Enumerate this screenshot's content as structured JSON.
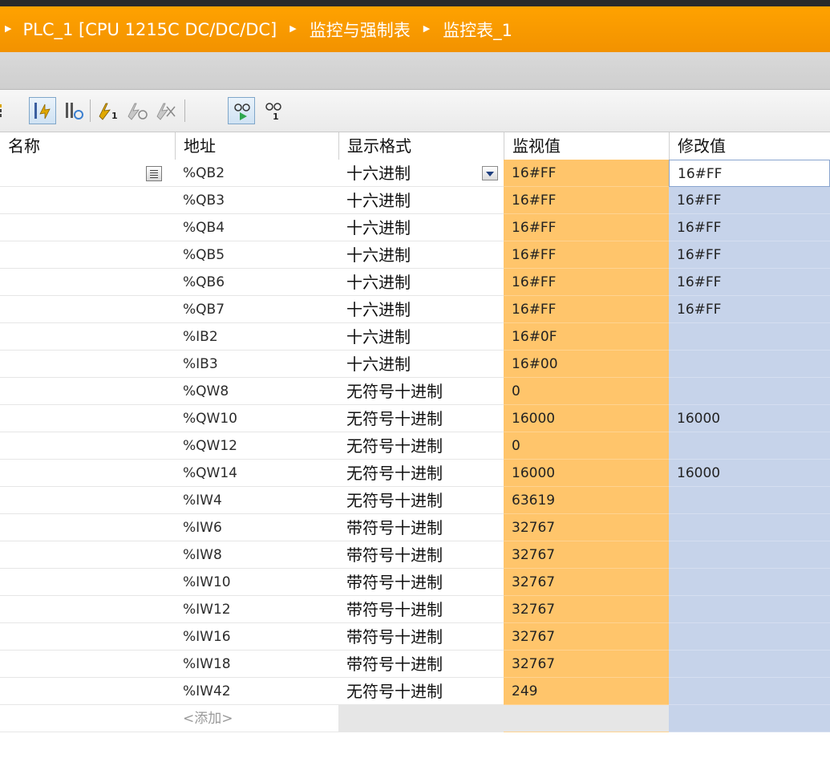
{
  "breadcrumb": {
    "items": [
      "PLC_1 [CPU 1215C DC/DC/DC]",
      "监控与强制表",
      "监控表_1"
    ]
  },
  "toolbar": {
    "icons": [
      "insert-row-icon",
      "monitor-all-icon",
      "monitor-once-icon",
      "modify-now-icon",
      "modify-trigger-icon",
      "enable-peripheral-icon",
      "monitor-all-toggle-icon",
      "monitor-once-glasses-icon"
    ]
  },
  "table": {
    "headers": {
      "name": "名称",
      "address": "地址",
      "format": "显示格式",
      "monitor": "监视值",
      "modify": "修改值"
    },
    "rows": [
      {
        "address": "%QB2",
        "format": "十六进制",
        "monitor": "16#FF",
        "modify": "16#FF"
      },
      {
        "address": "%QB3",
        "format": "十六进制",
        "monitor": "16#FF",
        "modify": "16#FF"
      },
      {
        "address": "%QB4",
        "format": "十六进制",
        "monitor": "16#FF",
        "modify": "16#FF"
      },
      {
        "address": "%QB5",
        "format": "十六进制",
        "monitor": "16#FF",
        "modify": "16#FF"
      },
      {
        "address": "%QB6",
        "format": "十六进制",
        "monitor": "16#FF",
        "modify": "16#FF"
      },
      {
        "address": "%QB7",
        "format": "十六进制",
        "monitor": "16#FF",
        "modify": "16#FF"
      },
      {
        "address": "%IB2",
        "format": "十六进制",
        "monitor": "16#0F",
        "modify": ""
      },
      {
        "address": "%IB3",
        "format": "十六进制",
        "monitor": "16#00",
        "modify": ""
      },
      {
        "address": "%QW8",
        "format": "无符号十进制",
        "monitor": "0",
        "modify": ""
      },
      {
        "address": "%QW10",
        "format": "无符号十进制",
        "monitor": "16000",
        "modify": "16000"
      },
      {
        "address": "%QW12",
        "format": "无符号十进制",
        "monitor": "0",
        "modify": ""
      },
      {
        "address": "%QW14",
        "format": "无符号十进制",
        "monitor": "16000",
        "modify": "16000"
      },
      {
        "address": "%IW4",
        "format": "无符号十进制",
        "monitor": "63619",
        "modify": ""
      },
      {
        "address": "%IW6",
        "format": "带符号十进制",
        "monitor": "32767",
        "modify": ""
      },
      {
        "address": "%IW8",
        "format": "带符号十进制",
        "monitor": "32767",
        "modify": ""
      },
      {
        "address": "%IW10",
        "format": "带符号十进制",
        "monitor": "32767",
        "modify": ""
      },
      {
        "address": "%IW12",
        "format": "带符号十进制",
        "monitor": "32767",
        "modify": ""
      },
      {
        "address": "%IW16",
        "format": "带符号十进制",
        "monitor": "32767",
        "modify": ""
      },
      {
        "address": "%IW18",
        "format": "带符号十进制",
        "monitor": "32767",
        "modify": ""
      },
      {
        "address": "%IW42",
        "format": "无符号十进制",
        "monitor": "249",
        "modify": ""
      }
    ],
    "add_row_label": "<添加>"
  },
  "colors": {
    "title_bar": "#f29200",
    "monitor_cell": "#ffc56b",
    "modify_cell": "#c6d3ea"
  }
}
